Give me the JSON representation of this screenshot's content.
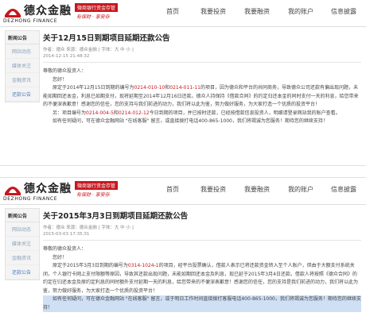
{
  "brand": {
    "cn": "德众金融",
    "en": "DEZHONG FINANCE",
    "badge": "微商银行资金存管",
    "slogan": "有保财 · 享安存"
  },
  "nav": [
    "首页",
    "我要投资",
    "我要融资",
    "我的账户",
    "信息披露"
  ],
  "colors": {
    "accent": "#c8161d",
    "link": "#4a7cc0",
    "sidebar_bg": "#f4f4f4"
  },
  "notice1": {
    "sidebar": {
      "head": "新闻公告",
      "items": [
        "网站动态",
        "媒体关注",
        "金融资讯",
        "还款公告"
      ],
      "active": 3
    },
    "title": "关于12月15日到期项目延期还款公告",
    "meta": "作者：德众  来源：德众金融  [ 字体：大 中 小 ]",
    "date": "2014-12-15 21:48:32",
    "greeting1": "尊敬的德众投资人：",
    "greeting2": "您好！",
    "p1a": "原定于2014年12月15日到期的编号为",
    "p1r1": "0214-010-10",
    "p1b": "和",
    "p1r2": "0214-011-11",
    "p1c": "的项目，因为德众和平台的共同商务，导致德众公司还款有偏出现问题，未能如期回还本金，利息已如期支付，现将延期至2014年12月16日还款。德众人持保持《借款合同》的约定归还本金的同时支付一天的利息，给您带来的不便深表歉意！感谢您的信任，您的支持与我们前进的动力，我们将以此为鉴，努力做好服务，为大家打造一个优质的投资平台！",
    "p2a": "另：项目编号为",
    "p2r1": "0214-004-5",
    "p2b": "和",
    "p2r2": "0214-012-12",
    "p2c": "今日到期的项目，并已按时还款，已经按借款信息投资人，明细请登录网站我的账户查看。",
    "p3": "如有任何疑问，可在德众金融网站 \"在线客服\" 留言，或直接拨打电话400-865-1000，我们将竭诚为您服务！期待您的继续支持！"
  },
  "notice2": {
    "sidebar": {
      "head": "新闻公告",
      "items": [
        "网站动态",
        "媒体关注",
        "金融资讯",
        "还款公告"
      ],
      "active": 3
    },
    "title": "关于2015年3月3日到期项目延期还款公告",
    "meta": "作者：德众  来源：德众金融  [ 字体：大 中 小 ]",
    "date": "2015-03-03 17:35:31",
    "greeting1": "尊敬的德众投资人：",
    "greeting2": "您好！",
    "p1a": "原定于2015年3月3日到期的编号为",
    "p1r1": "0314-1024-1",
    "p1b": "的项目，经平台投票确认，借款人表示已将还款资金转入至个人账户，但由于大额支付系统关闭，个人银行卡网上支付限额等原因，导致其还款出现问题，未能如期回还本金及利息，现已延于2015年3月4日还款。借款人将按照《德众合同》的约定在归还本金及原约定利息的同时额外支付延期一天的利息，给您带来的不便深表歉意！感谢您的信任，您的支持是我们前进的动力，我们将以此为鉴，努力做好服务，为大家打造一个优质的投资平台！",
    "p2": "如有任何疑问，可在德众金融网站 \"在线客服\" 留言，或于明日工作时间直接拨打客服电话400-865-1000，我们将竭诚为您服务！期待您的继续支持！"
  }
}
